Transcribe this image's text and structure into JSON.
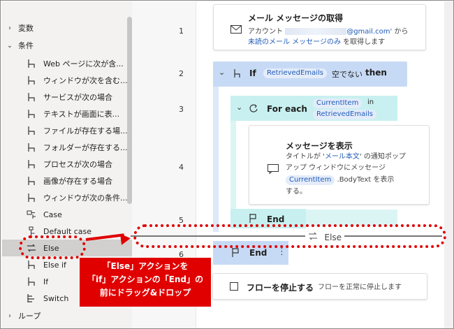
{
  "sidebar": {
    "groups": [
      {
        "label": "変数",
        "expanded": false
      },
      {
        "label": "条件",
        "expanded": true
      },
      {
        "label": "ループ",
        "expanded": false
      }
    ],
    "items": [
      {
        "label": "Web ページに次が含...",
        "icon": "branch-icon"
      },
      {
        "label": "ウィンドウが次を含む...",
        "icon": "branch-icon"
      },
      {
        "label": "サービスが次の場合",
        "icon": "branch-icon"
      },
      {
        "label": "テキストが画面に表...",
        "icon": "branch-icon"
      },
      {
        "label": "ファイルが存在する場...",
        "icon": "branch-icon"
      },
      {
        "label": "フォルダーが存在する...",
        "icon": "branch-icon"
      },
      {
        "label": "プロセスが次の場合",
        "icon": "branch-icon"
      },
      {
        "label": "画像が存在する場合",
        "icon": "branch-icon"
      },
      {
        "label": "ウィンドウが次の条件...",
        "icon": "branch-icon"
      },
      {
        "label": "Case",
        "icon": "case-icon"
      },
      {
        "label": "Default case",
        "icon": "default-case-icon"
      },
      {
        "label": "Else",
        "icon": "else-icon"
      },
      {
        "label": "Else if",
        "icon": "branch-icon"
      },
      {
        "label": "If",
        "icon": "branch-icon"
      },
      {
        "label": "Switch",
        "icon": "switch-icon"
      }
    ]
  },
  "flow": {
    "line_numbers": [
      "1",
      "2",
      "3",
      "4",
      "5",
      "6"
    ],
    "step1": {
      "title": "メール メッセージの取得",
      "desc_prefix": "アカウント",
      "desc_email": "@gmail.com'",
      "desc_mid": " から",
      "desc_link": "未読のメール メッセージのみ",
      "desc_suffix": " を取得します"
    },
    "if_block": {
      "keyword": "If",
      "variable": "RetrievedEmails",
      "condition": "空でない",
      "then": "then"
    },
    "foreach_block": {
      "keyword": "For each",
      "item_var": "CurrentItem",
      "in": "in",
      "list_var": "RetrievedEmails"
    },
    "show_message": {
      "title": "メッセージを表示",
      "desc1": "タイトルが '",
      "desc1_link": "メール本文",
      "desc1_end": "' の通知ポップ",
      "desc2": "アップ ウィンドウにメッセージ",
      "token": "CurrentItem",
      "desc3_end": ".BodyText を表示",
      "desc4": "する。"
    },
    "foreach_end": "End",
    "else_drop_label": "Else",
    "if_end": "End",
    "stop_flow": {
      "title": "フローを停止する",
      "desc": "フローを正常に停止します"
    }
  },
  "annotation": {
    "text": "「Else」アクションを\n「if」アクションの「End」の\n前にドラッグ&ドロップ"
  },
  "colors": {
    "annotation_red": "#e00000",
    "if_block": "#c7daf5",
    "foreach_block": "#c8f0f0",
    "token_bg": "#e4ecfa",
    "token_text": "#1f5bb8"
  }
}
